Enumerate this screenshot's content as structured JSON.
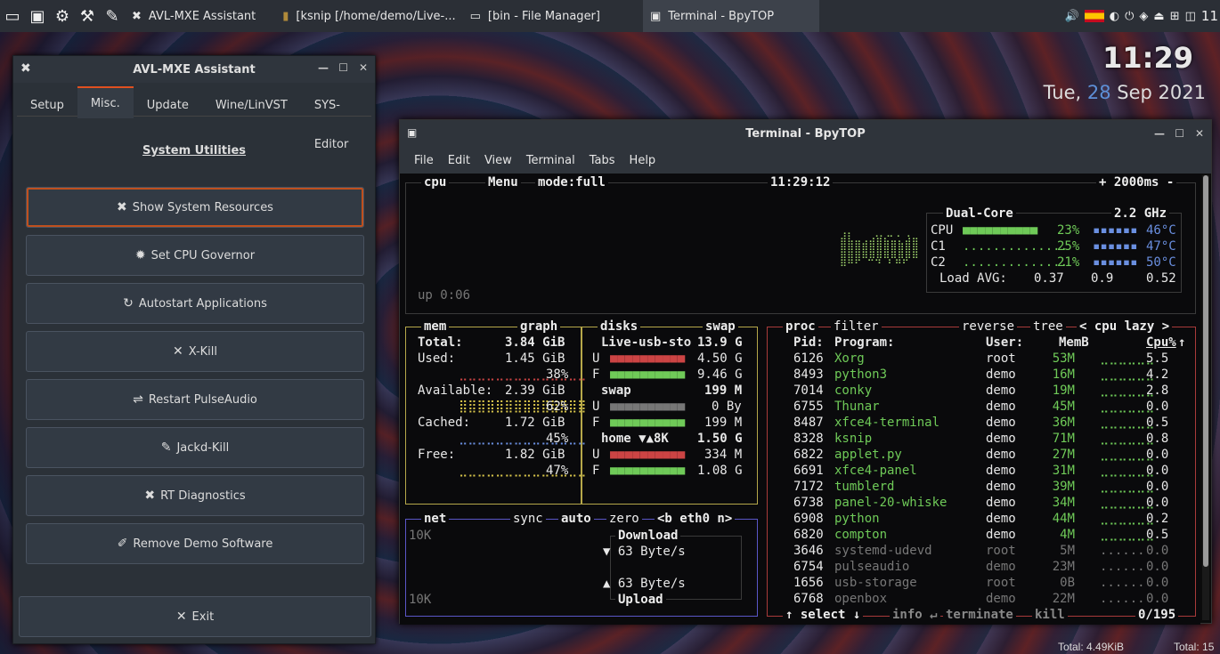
{
  "taskbar": {
    "tasks": [
      {
        "label": "AVL-MXE Assistant",
        "icon": "tools-icon",
        "active": false
      },
      {
        "label": "[ksnip [/home/demo/Live-...",
        "icon": "ksnip-icon",
        "active": false
      },
      {
        "label": "[bin - File Manager]",
        "icon": "folder-icon",
        "active": false
      },
      {
        "label": "Terminal - BpyTOP",
        "icon": "terminal-icon",
        "active": true
      }
    ],
    "tray_time": "11"
  },
  "clock": {
    "time": "11:29",
    "date_prefix": "Tue,",
    "day": "28",
    "date_suffix": "Sep 2021"
  },
  "assistant": {
    "title": "AVL-MXE Assistant",
    "tabs": [
      "Setup",
      "Misc.",
      "Update",
      "Wine/LinVST",
      "SYS-Editor"
    ],
    "selected_tab": "Misc.",
    "section_title": "System Utilities",
    "buttons": [
      {
        "label": "Show System Resources",
        "icon": "tools-icon"
      },
      {
        "label": "Set CPU Governor",
        "icon": "gear-icon"
      },
      {
        "label": "Autostart Applications",
        "icon": "refresh-icon"
      },
      {
        "label": "X-Kill",
        "icon": "close-icon"
      },
      {
        "label": "Restart PulseAudio",
        "icon": "switch-icon"
      },
      {
        "label": "Jackd-Kill",
        "icon": "pen-icon"
      },
      {
        "label": "RT Diagnostics",
        "icon": "tools-icon"
      },
      {
        "label": "Remove Demo Software",
        "icon": "edit-icon"
      }
    ],
    "exit_label": "Exit"
  },
  "terminal": {
    "title": "Terminal - BpyTOP",
    "menu": [
      "File",
      "Edit",
      "View",
      "Terminal",
      "Tabs",
      "Help"
    ],
    "cpu": {
      "label": "cpu",
      "menu": "Menu",
      "mode": "mode:full",
      "time": "11:29:12",
      "interval": "2000ms",
      "uptime": "up 0:06",
      "model": "Dual-Core",
      "freq": "2.2 GHz",
      "rows": [
        {
          "name": "CPU",
          "pct": "23%",
          "temp": "46°C"
        },
        {
          "name": "C1",
          "pct": "25%",
          "temp": "47°C"
        },
        {
          "name": "C2",
          "pct": "21%",
          "temp": "50°C"
        }
      ],
      "load_label": "Load AVG:",
      "load": [
        "0.37",
        "0.9",
        "0.52"
      ]
    },
    "mem": {
      "label": "mem",
      "graph": "graph",
      "total_label": "Total:",
      "total": "3.84 GiB",
      "used_label": "Used:",
      "used": "1.45 GiB",
      "used_pct": "38%",
      "avail_label": "Available:",
      "avail": "2.39 GiB",
      "avail_pct": "62%",
      "cached_label": "Cached:",
      "cached": "1.72 GiB",
      "cached_pct": "45%",
      "free_label": "Free:",
      "free": "1.82 GiB",
      "free_pct": "47%"
    },
    "disks": {
      "label": "disks",
      "swap_label": "swap",
      "d1_name": "Live-usb-sto",
      "d1_size": "13.9 G",
      "d1_used": "4.50 G",
      "d1_free": "9.46 G",
      "swap_name": "swap",
      "swap_size": "199 M",
      "swap_used": "0 By",
      "swap_free": "199 M",
      "home_name": "home ▼▲8K",
      "home_size": "1.50 G",
      "home_used": "334 M",
      "home_free": "1.08 G"
    },
    "net": {
      "label": "net",
      "sync": "sync",
      "auto": "auto",
      "zero": "zero",
      "iface": "<b eth0 n>",
      "scale_top": "10K",
      "scale_bottom": "10K",
      "download_label": "Download",
      "download": "▼ 63 Byte/s",
      "upload": "▲ 63 Byte/s",
      "upload_label": "Upload"
    },
    "proc": {
      "label": "proc",
      "filter": "filter",
      "reverse": "reverse",
      "tree": "tree",
      "sort": "< cpu lazy >",
      "headers": [
        "Pid:",
        "Program:",
        "User:",
        "MemB",
        "Cpu%"
      ],
      "rows": [
        [
          "6126",
          "Xorg",
          "root",
          "53M",
          "5.5"
        ],
        [
          "8493",
          "python3",
          "demo",
          "16M",
          "4.2"
        ],
        [
          "7014",
          "conky",
          "demo",
          "19M",
          "2.8"
        ],
        [
          "6755",
          "Thunar",
          "demo",
          "45M",
          "0.0"
        ],
        [
          "8487",
          "xfce4-terminal",
          "demo",
          "36M",
          "0.5"
        ],
        [
          "8328",
          "ksnip",
          "demo",
          "71M",
          "0.8"
        ],
        [
          "6822",
          "applet.py",
          "demo",
          "27M",
          "0.0"
        ],
        [
          "6691",
          "xfce4-panel",
          "demo",
          "31M",
          "0.0"
        ],
        [
          "7172",
          "tumblerd",
          "demo",
          "39M",
          "0.0"
        ],
        [
          "6738",
          "panel-20-whiske",
          "demo",
          "34M",
          "0.0"
        ],
        [
          "6908",
          "python",
          "demo",
          "44M",
          "0.2"
        ],
        [
          "6820",
          "compton",
          "demo",
          "4M",
          "0.5"
        ],
        [
          "3646",
          "systemd-udevd",
          "root",
          "5M",
          "0.0"
        ],
        [
          "6754",
          "pulseaudio",
          "demo",
          "23M",
          "0.0"
        ],
        [
          "1656",
          "usb-storage",
          "root",
          "0B",
          "0.0"
        ],
        [
          "6768",
          "openbox",
          "demo",
          "22M",
          "0.0"
        ]
      ],
      "footer_select": "↑ select ↓",
      "footer_info": "info ↵",
      "footer_terminate": "terminate",
      "footer_kill": "kill",
      "count": "0/195"
    }
  },
  "bottom": {
    "total_left": "Total: 4.49KiB",
    "total_right": "Total: 15"
  }
}
